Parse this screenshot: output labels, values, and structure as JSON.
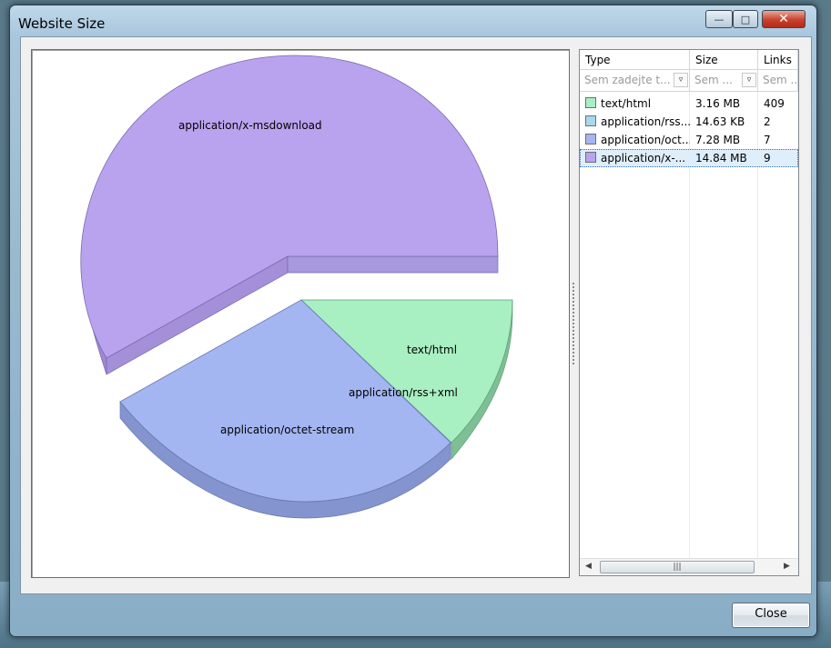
{
  "window": {
    "title": "Website Size"
  },
  "grid": {
    "columns": [
      "Type",
      "Size",
      "Links"
    ],
    "filters": [
      "Sem zadejte t...",
      "Sem ...",
      "Sem ..."
    ],
    "rows": [
      {
        "type": "text/html",
        "size": "3.16 MB",
        "links": "409",
        "color": "#a8efc2"
      },
      {
        "type": "application/rss...",
        "size": "14.63 KB",
        "links": "2",
        "color": "#a8d8ec"
      },
      {
        "type": "application/oct...",
        "size": "7.28 MB",
        "links": "7",
        "color": "#a5b5f0"
      },
      {
        "type": "application/x-...",
        "size": "14.84 MB",
        "links": "9",
        "color": "#b9a3ee",
        "selected": true
      }
    ]
  },
  "chart_data": {
    "type": "pie",
    "series": [
      {
        "label": "application/x-msdownload",
        "value": 14.84,
        "color": "#baa3ee",
        "side": "#9e89d0"
      },
      {
        "label": "text/html",
        "value": 3.16,
        "color": "#a8efc2",
        "side": "#7ebf95"
      },
      {
        "label": "application/rss+xml",
        "value": 0.014,
        "color": "#a8d8ec",
        "side": "#86b6c9"
      },
      {
        "label": "application/octet-stream",
        "value": 7.28,
        "color": "#a3b6f1",
        "side": "#8494ce"
      }
    ],
    "unit": "MB"
  },
  "buttons": {
    "close": "Close"
  }
}
